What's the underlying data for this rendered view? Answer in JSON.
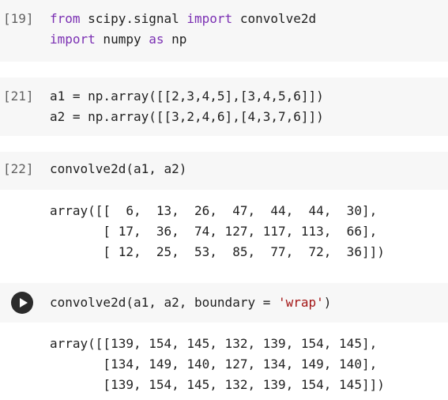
{
  "cells": [
    {
      "prompt": "[19]",
      "lines": [
        [
          {
            "t": "from",
            "c": "kw"
          },
          {
            "t": " scipy.signal ",
            "c": "fn"
          },
          {
            "t": "import",
            "c": "kw"
          },
          {
            "t": " convolve2d",
            "c": "fn"
          }
        ],
        [
          {
            "t": "import",
            "c": "kw"
          },
          {
            "t": " numpy ",
            "c": "fn"
          },
          {
            "t": "as",
            "c": "kw"
          },
          {
            "t": " np",
            "c": "fn"
          }
        ]
      ]
    },
    {
      "prompt": "[21]",
      "lines": [
        [
          {
            "t": "a1 = np.array([[2,3,4,5],[3,4,5,6]])",
            "c": "fn"
          }
        ],
        [
          {
            "t": "a2 = np.array([[3,2,4,6],[4,3,7,6]])",
            "c": "fn"
          }
        ]
      ]
    },
    {
      "prompt": "[22]",
      "lines": [
        [
          {
            "t": "convolve2d(a1, a2)",
            "c": "fn"
          }
        ]
      ],
      "output": [
        "array([[  6,  13,  26,  47,  44,  44,  30],",
        "       [ 17,  36,  74, 127, 117, 113,  66],",
        "       [ 12,  25,  53,  85,  77,  72,  36]])"
      ]
    },
    {
      "prompt": "",
      "run_button": true,
      "lines": [
        [
          {
            "t": "convolve2d(a1, a2, boundary = ",
            "c": "fn"
          },
          {
            "t": "'wrap'",
            "c": "str"
          },
          {
            "t": ")",
            "c": "fn"
          }
        ]
      ],
      "output": [
        "array([[139, 154, 145, 132, 139, 154, 145],",
        "       [134, 149, 140, 127, 134, 149, 140],",
        "       [139, 154, 145, 132, 139, 154, 145]])"
      ]
    }
  ]
}
